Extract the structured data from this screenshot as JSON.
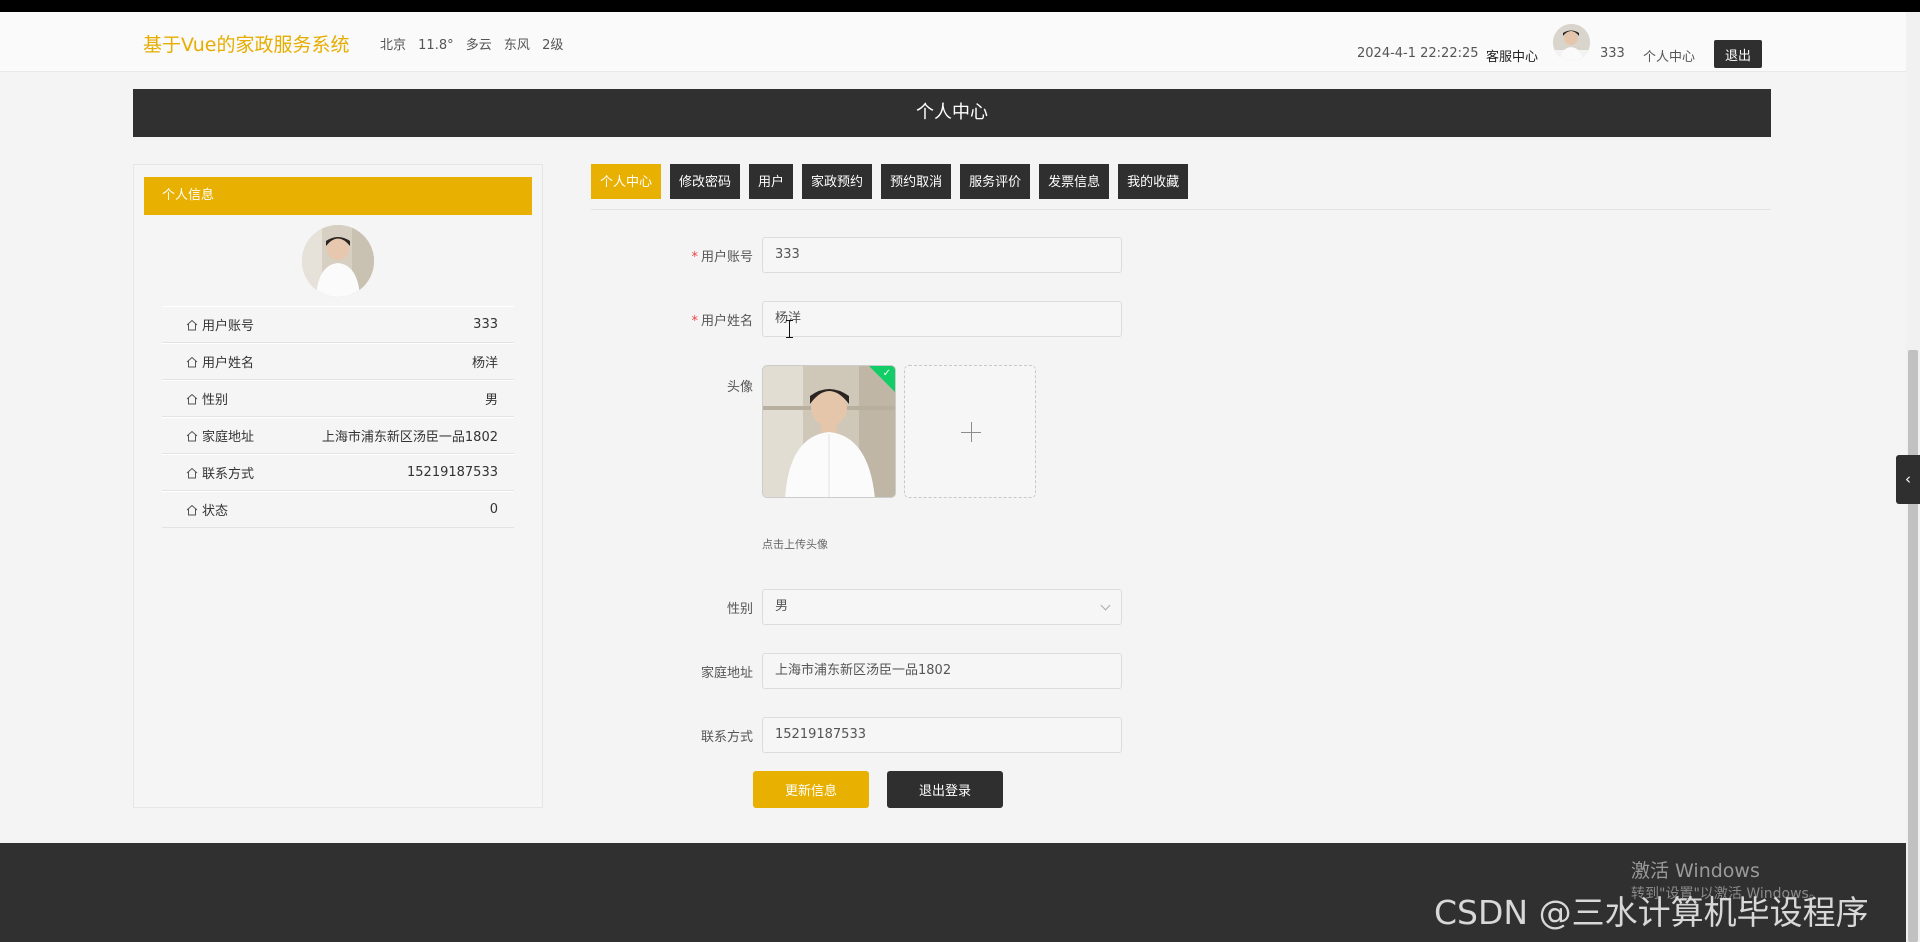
{
  "header": {
    "site_title": "基于Vue的家政服务系统",
    "weather": {
      "city": "北京",
      "temp": "11.8°",
      "condition": "多云",
      "wind": "东风",
      "level": "2级"
    },
    "datetime": "2024-4-1 22:22:25",
    "service_center": "客服中心",
    "username": "333",
    "personal_center": "个人中心",
    "logout": "退出"
  },
  "banner": {
    "title": "个人中心"
  },
  "sidebar": {
    "heading": "个人信息",
    "rows": [
      {
        "key": "用户账号",
        "value": "333"
      },
      {
        "key": "用户姓名",
        "value": "杨洋"
      },
      {
        "key": "性别",
        "value": "男"
      },
      {
        "key": "家庭地址",
        "value": "上海市浦东新区汤臣一品1802"
      },
      {
        "key": "联系方式",
        "value": "15219187533"
      },
      {
        "key": "状态",
        "value": "0"
      }
    ]
  },
  "tabs": [
    "个人中心",
    "修改密码",
    "用户",
    "家政预约",
    "预约取消",
    "服务评价",
    "发票信息",
    "我的收藏"
  ],
  "form": {
    "account_label": "用户账号",
    "account_value": "333",
    "name_label": "用户姓名",
    "name_value": "杨洋",
    "avatar_label": "头像",
    "avatar_hint": "点击上传头像",
    "gender_label": "性别",
    "gender_value": "男",
    "address_label": "家庭地址",
    "address_value": "上海市浦东新区汤臣一品1802",
    "phone_label": "联系方式",
    "phone_value": "15219187533",
    "update_button": "更新信息",
    "logout_button": "退出登录"
  },
  "overlay": {
    "activate_title": "激活 Windows",
    "activate_sub": "转到\"设置\"以激活 Windows。",
    "watermark": "CSDN @三水计算机毕设程序"
  },
  "colors": {
    "accent": "#e8b000",
    "dark": "#2f2f2f",
    "success": "#13ce66"
  }
}
